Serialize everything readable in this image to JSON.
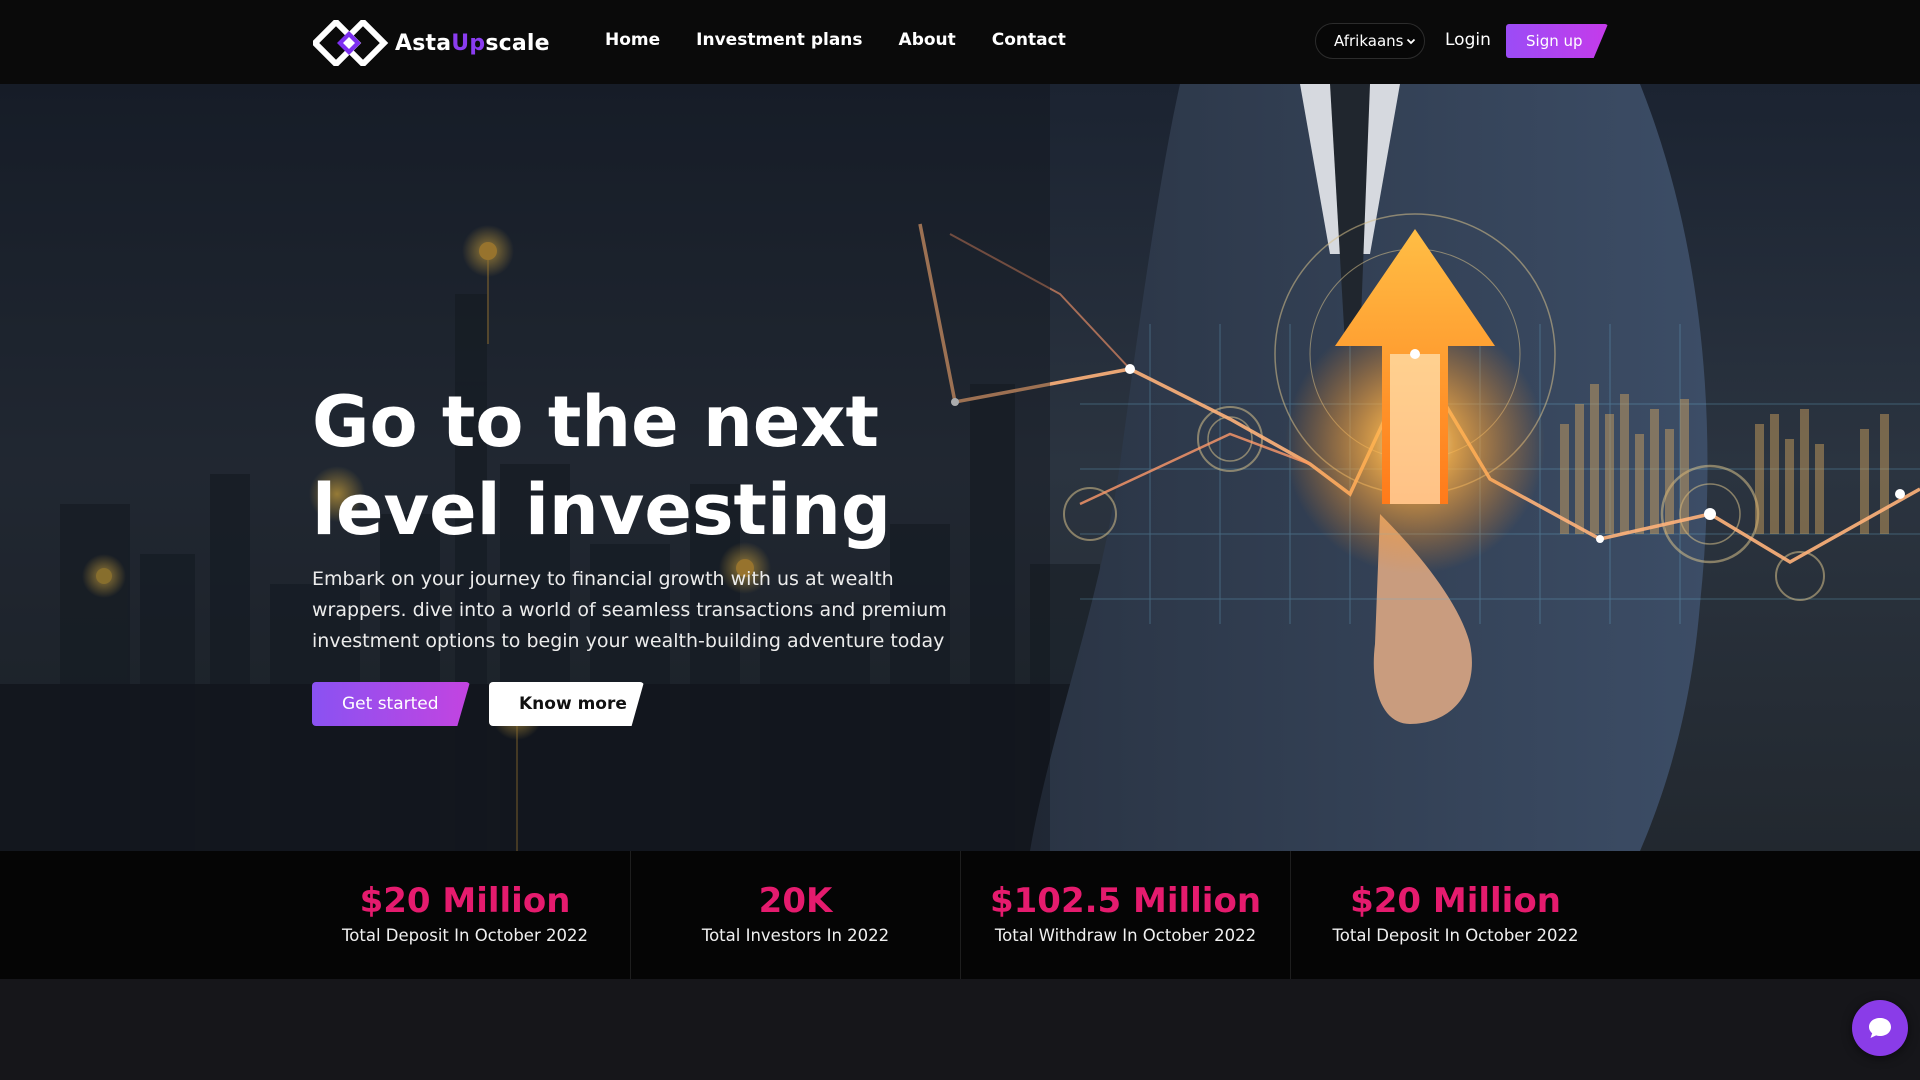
{
  "brand": {
    "name_part1": "Asta",
    "name_part2": "Up",
    "name_part3": "scale"
  },
  "nav": {
    "items": [
      "Home",
      "Investment plans",
      "About",
      "Contact"
    ],
    "language": "Afrikaans",
    "login": "Login",
    "signup": "Sign up"
  },
  "hero": {
    "title": "Go to the next level investing",
    "description": "Embark on your journey to financial growth with us at wealth wrappers. dive into a world of seamless transactions and premium investment options to begin your wealth-building adventure today",
    "cta_primary": "Get started",
    "cta_secondary": "Know more"
  },
  "stats": [
    {
      "value": "$20 Million",
      "label": "Total Deposit In October 2022"
    },
    {
      "value": "20K",
      "label": "Total Investors In 2022"
    },
    {
      "value": "$102.5 Million",
      "label": "Total Withdraw In October 2022"
    },
    {
      "value": "$20 Million",
      "label": "Total Deposit In October 2022"
    }
  ],
  "colors": {
    "accent_purple": "#8a3cf0",
    "stat_pink": "#e51b6e",
    "header_bg": "#0a0a0a"
  },
  "icons": {
    "logo": "diamond-logo-icon",
    "language_chevron": "chevron-down-icon",
    "chat": "chat-bubble-icon"
  }
}
